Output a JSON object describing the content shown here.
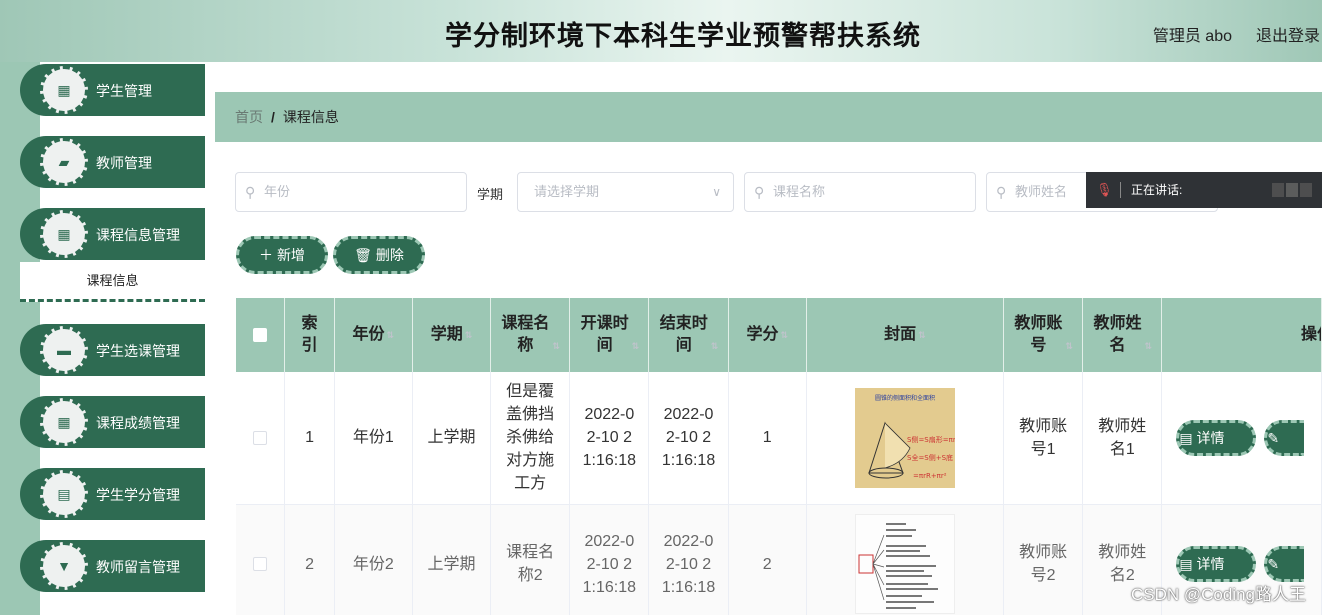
{
  "header": {
    "title": "学分制环境下本科生学业预警帮扶系统",
    "user": "管理员 abo",
    "logout": "退出登录"
  },
  "sidebar": {
    "items": [
      {
        "label": "学生管理",
        "icon": "grid-icon"
      },
      {
        "label": "教师管理",
        "icon": "wallet-icon"
      },
      {
        "label": "课程信息管理",
        "icon": "grid-icon"
      },
      {
        "label": "学生选课管理",
        "icon": "briefcase-icon"
      },
      {
        "label": "课程成绩管理",
        "icon": "grid-icon"
      },
      {
        "label": "学生学分管理",
        "icon": "clipboard-icon"
      },
      {
        "label": "教师留言管理",
        "icon": "trophy-icon"
      }
    ],
    "submenu": "课程信息"
  },
  "breadcrumb": {
    "home": "首页",
    "sep": "/",
    "current": "课程信息"
  },
  "filters": {
    "year_placeholder": "年份",
    "term_label": "学期",
    "term_placeholder": "请选择学期",
    "course_placeholder": "课程名称",
    "teacher_placeholder": "教师姓名"
  },
  "actions": {
    "add": "新增",
    "delete": "删除"
  },
  "toast": {
    "text": "正在讲话:"
  },
  "table": {
    "headers": [
      "索引",
      "年份",
      "学期",
      "课程名称",
      "开课时间",
      "结束时间",
      "学分",
      "封面",
      "教师账号",
      "教师姓名",
      "操作"
    ],
    "rows": [
      {
        "index": "1",
        "year": "年份1",
        "term": "上学期",
        "course": "但是覆盖佛挡杀佛给对方施工方",
        "start": "2022-02-10 21:16:18",
        "end": "2022-02-10 21:16:18",
        "credit": "1",
        "teacher_account": "教师账号1",
        "teacher_name": "教师姓名1",
        "detail": "详情"
      },
      {
        "index": "2",
        "year": "年份2",
        "term": "上学期",
        "course": "课程名称2",
        "start": "2022-02-10 21:16:18",
        "end": "2022-02-10 21:16:18",
        "credit": "2",
        "teacher_account": "教师账号2",
        "teacher_name": "教师姓名2",
        "detail": "详情"
      }
    ]
  },
  "cover1": {
    "title": "圆锥的侧面积和全面积",
    "formula1": "S侧=S扇形=πrR",
    "formula2": "S全=S侧+S底",
    "formula3": "=πrR+πr²"
  },
  "watermark": "CSDN @Coding路人王",
  "colors": {
    "primary": "#2e6b52",
    "light": "#9cc7b4"
  }
}
